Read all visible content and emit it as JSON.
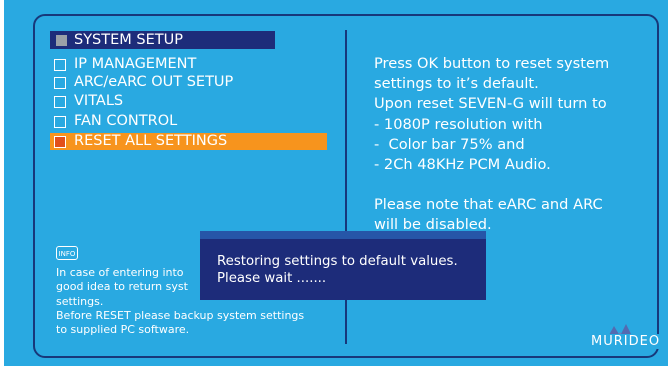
{
  "menu": {
    "title": "SYSTEM SETUP",
    "items": [
      {
        "label": "IP MANAGEMENT",
        "selected": false
      },
      {
        "label": "ARC/eARC OUT SETUP",
        "selected": false
      },
      {
        "label": "VITALS",
        "selected": false
      },
      {
        "label": "FAN CONTROL",
        "selected": false
      },
      {
        "label": "RESET ALL SETTINGS",
        "selected": true
      }
    ]
  },
  "info_panel": {
    "lines": [
      "Press OK button to reset system",
      "settings to it’s default.",
      "Upon reset SEVEN-G will turn to",
      "- 1080P resolution with",
      "-  Color bar 75% and",
      "- 2Ch 48KHz PCM Audio.",
      "",
      "Please note that eARC and ARC",
      "will be disabled."
    ]
  },
  "note": {
    "icon_label": "INFO",
    "lines": [
      "In case of entering into",
      "good idea to return syst",
      "settings.",
      "Before RESET please backup system settings",
      "to supplied PC software."
    ]
  },
  "dialog": {
    "line1": "Restoring settings to default values.",
    "line2": "Please wait ......."
  },
  "brand": {
    "logo_text": "MURIDEO"
  },
  "colors": {
    "background": "#29a9e1",
    "navy": "#1d2c7a",
    "highlight": "#f7941d",
    "highlight_box": "#e2501c"
  }
}
